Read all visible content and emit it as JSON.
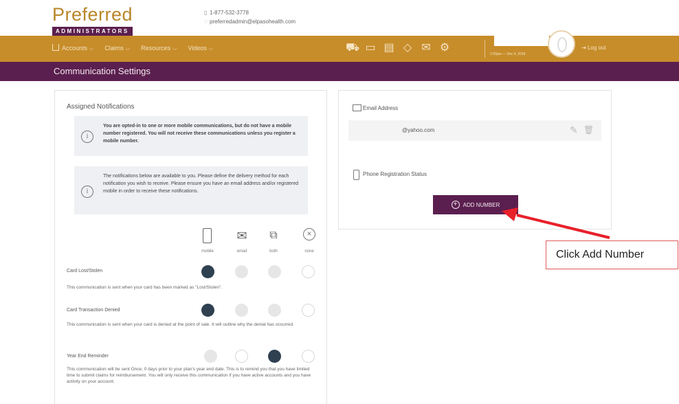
{
  "header": {
    "logo_word": "Preferred",
    "logo_sub": "ADMINISTRATORS",
    "phone": "1-877-532-3778",
    "email": "preferredadmin@elpasohealth.com"
  },
  "nav": {
    "items": [
      {
        "label": "Accounts ⌵"
      },
      {
        "label": "Claims ⌵"
      },
      {
        "label": "Resources ⌵"
      },
      {
        "label": "Videos ⌵"
      }
    ],
    "icons": [
      "cart-icon",
      "chat-icon",
      "card-icon",
      "pin-icon",
      "envelope-icon",
      "gear-icon"
    ],
    "date_text": "1:00pm — Dec 4, 2018",
    "logout_label": "Log out"
  },
  "page_title": "Communication Settings",
  "assigned": {
    "title": "Assigned Notifications",
    "info1": "You are opted-in to one or more mobile communications, but do not have a mobile number registered. You will not receive these communications unless you register a mobile number.",
    "info2": "The notifications below are available to you. Please define the delivery method for each notification you wish to receive. Please ensure you have an email address and/or registered mobile in order to receive these notifications.",
    "options": [
      "mobile",
      "email",
      "both",
      "none"
    ],
    "notifications": [
      {
        "title": "Card Lost/Stolen",
        "desc": "This communication is sent when your card has been marked as \"Lost/Stolen\".",
        "states": [
          "selected",
          "disabled",
          "disabled",
          "empty"
        ]
      },
      {
        "title": "Card Transaction Denied",
        "desc": "This communication is sent when your card is denied at the point of sale. It will outline why the denial has occurred.",
        "states": [
          "selected",
          "disabled",
          "disabled",
          "empty"
        ]
      },
      {
        "title": "Year End Reminder",
        "desc": "This communication will be sent Once, 0 days prior to your plan's year end date. This is to remind you that you have limited time to submit claims for reimbursement. You will only receive this communication if you have active accounts and you have activity on your account.",
        "states": [
          "disabled",
          "empty",
          "selected",
          "empty"
        ]
      }
    ]
  },
  "contact_settings": {
    "email_label": "Email Address",
    "email_value": "@yahoo.com",
    "phone_label": "Phone Registration Status",
    "add_number_label": "ADD NUMBER"
  },
  "annotation": {
    "text": "Click Add Number",
    "color": "#e8202a"
  },
  "colors": {
    "brand_gold": "#c78d2a",
    "brand_purple": "#5b1f4f",
    "radio_selected": "#2f4050"
  }
}
